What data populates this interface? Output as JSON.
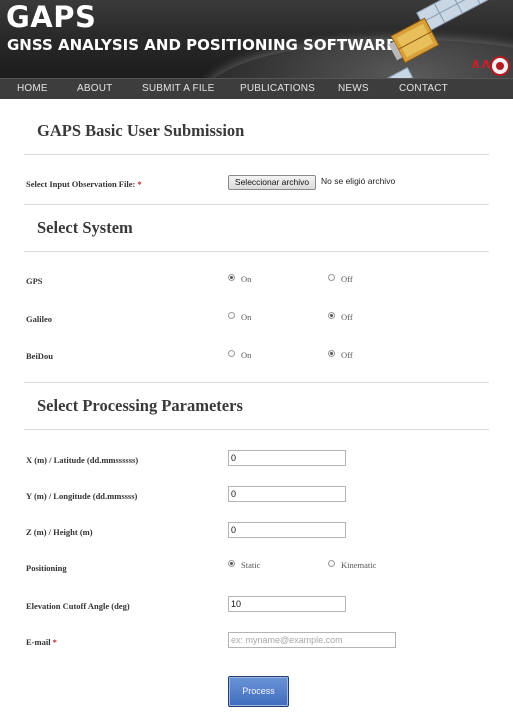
{
  "header": {
    "title": "GAPS",
    "subtitle": "GNSS ANALYSIS AND POSITIONING SOFTWARE",
    "logo_mark": "∧ʌ",
    "background_color": "#2a2a2a"
  },
  "nav": {
    "items": [
      "HOME",
      "ABOUT",
      "SUBMIT A FILE",
      "PUBLICATIONS",
      "NEWS",
      "CONTACT"
    ],
    "background_color": "#3d3d3d"
  },
  "basic": {
    "heading": "GAPS Basic User Submission",
    "file_label": "Select Input Observation File:",
    "required_mark": "*",
    "file_button": "Seleccionar archivo",
    "file_status": "No se eligió archivo"
  },
  "system": {
    "heading": "Select System",
    "rows": [
      {
        "label": "GPS",
        "on_label": "On",
        "off_label": "Off",
        "selected": "On"
      },
      {
        "label": "Galileo",
        "on_label": "On",
        "off_label": "Off",
        "selected": "Off"
      },
      {
        "label": "BeiDou",
        "on_label": "On",
        "off_label": "Off",
        "selected": "Off"
      }
    ]
  },
  "params": {
    "heading": "Select Processing Parameters",
    "x_label": "X (m) / Latitude (dd.mmssssss)",
    "x_value": "0",
    "y_label": "Y (m) / Longitude (dd.mmssss)",
    "y_value": "0",
    "z_label": "Z (m) / Height (m)",
    "z_value": "0",
    "positioning_label": "Positioning",
    "static_label": "Static",
    "kinematic_label": "Kinematic",
    "positioning_selected": "Static",
    "cutoff_label": "Elevation Cutoff Angle (deg)",
    "cutoff_value": "10",
    "email_label": "E-mail",
    "email_required_mark": "*",
    "email_placeholder": "ex: myname@example.com",
    "email_value": ""
  },
  "process_button": "Process",
  "colors": {
    "required": "#c0282d",
    "process_button": "#4a78c6"
  }
}
